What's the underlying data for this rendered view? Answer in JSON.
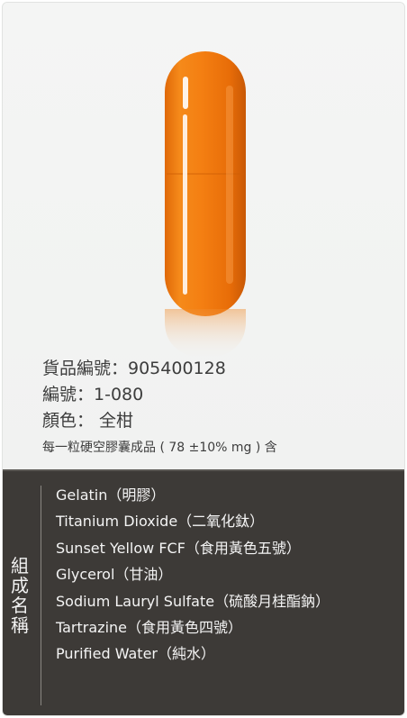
{
  "product": {
    "item_no": "貨品編號：905400128",
    "code": "編號：1-080",
    "color": "顏色： 全柑",
    "note": "每一粒硬空膠囊成品 ( 78 ±10% mg ) 含"
  },
  "composition": {
    "title_chars": [
      "組",
      "成",
      "名",
      "稱"
    ],
    "items": [
      "Gelatin（明膠）",
      "Titanium Dioxide（二氧化鈦）",
      "Sunset Yellow FCF（食用黃色五號）",
      " Glycerol（甘油）",
      "Sodium Lauryl Sulfate（硫酸月桂酯鈉）",
      "Tartrazine（食用黃色四號）",
      "Purified Water（純水）"
    ]
  },
  "colors": {
    "capsule": "#f07a10",
    "capsule_dark": "#d85f05",
    "panel": "#3d3a37"
  },
  "icons": {
    "capsule": "capsule-image"
  }
}
